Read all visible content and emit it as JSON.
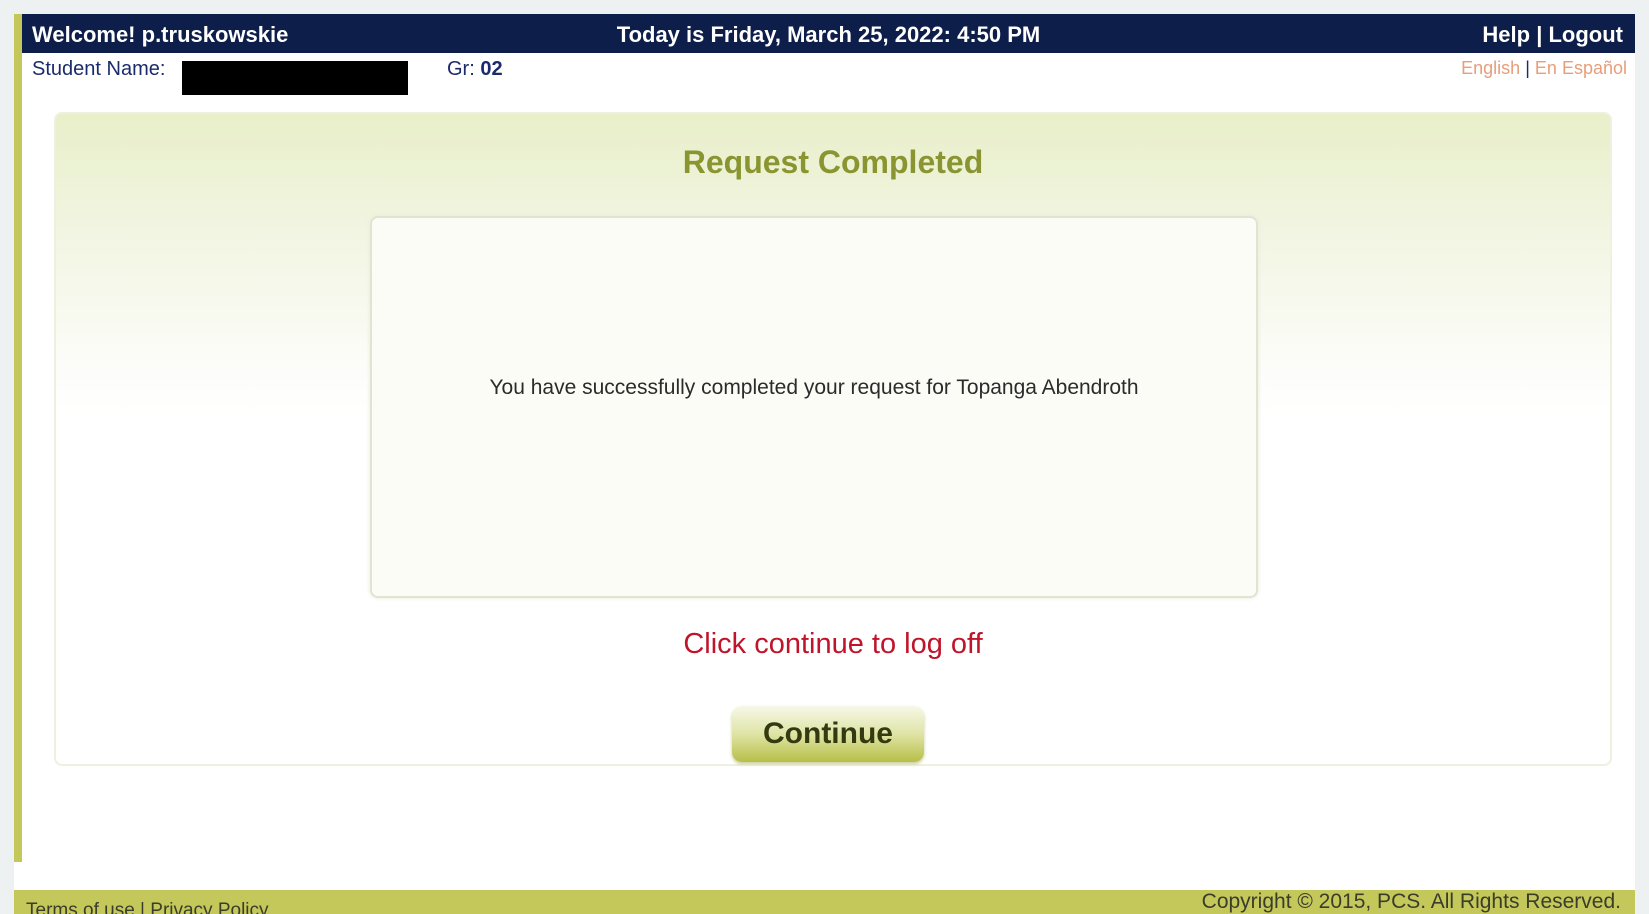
{
  "header": {
    "welcome": "Welcome! p.truskowskie",
    "today": "Today is Friday, March 25, 2022: 4:50 PM",
    "help_label": "Help",
    "separator": "|",
    "logout_label": "Logout"
  },
  "student": {
    "name_label": "Student Name:",
    "grade_label": "Gr:",
    "grade_value": "02"
  },
  "language": {
    "english": "English",
    "separator": "|",
    "spanish": "En Español"
  },
  "panel": {
    "title": "Request Completed",
    "message": "You have successfully completed your request for Topanga Abendroth",
    "instruction": "Click continue to log off",
    "continue_label": "Continue"
  },
  "footer": {
    "terms": "Terms of use",
    "separator": "|",
    "privacy": "Privacy Policy",
    "copyright": "Copyright © 2015, PCS. All Rights Reserved."
  },
  "colors": {
    "topbar": "#0d1e4a",
    "accent_olive": "#8a9532",
    "instruction_red": "#c0142a",
    "footer_band": "#c4c85a",
    "language_link": "#e79e7a"
  }
}
